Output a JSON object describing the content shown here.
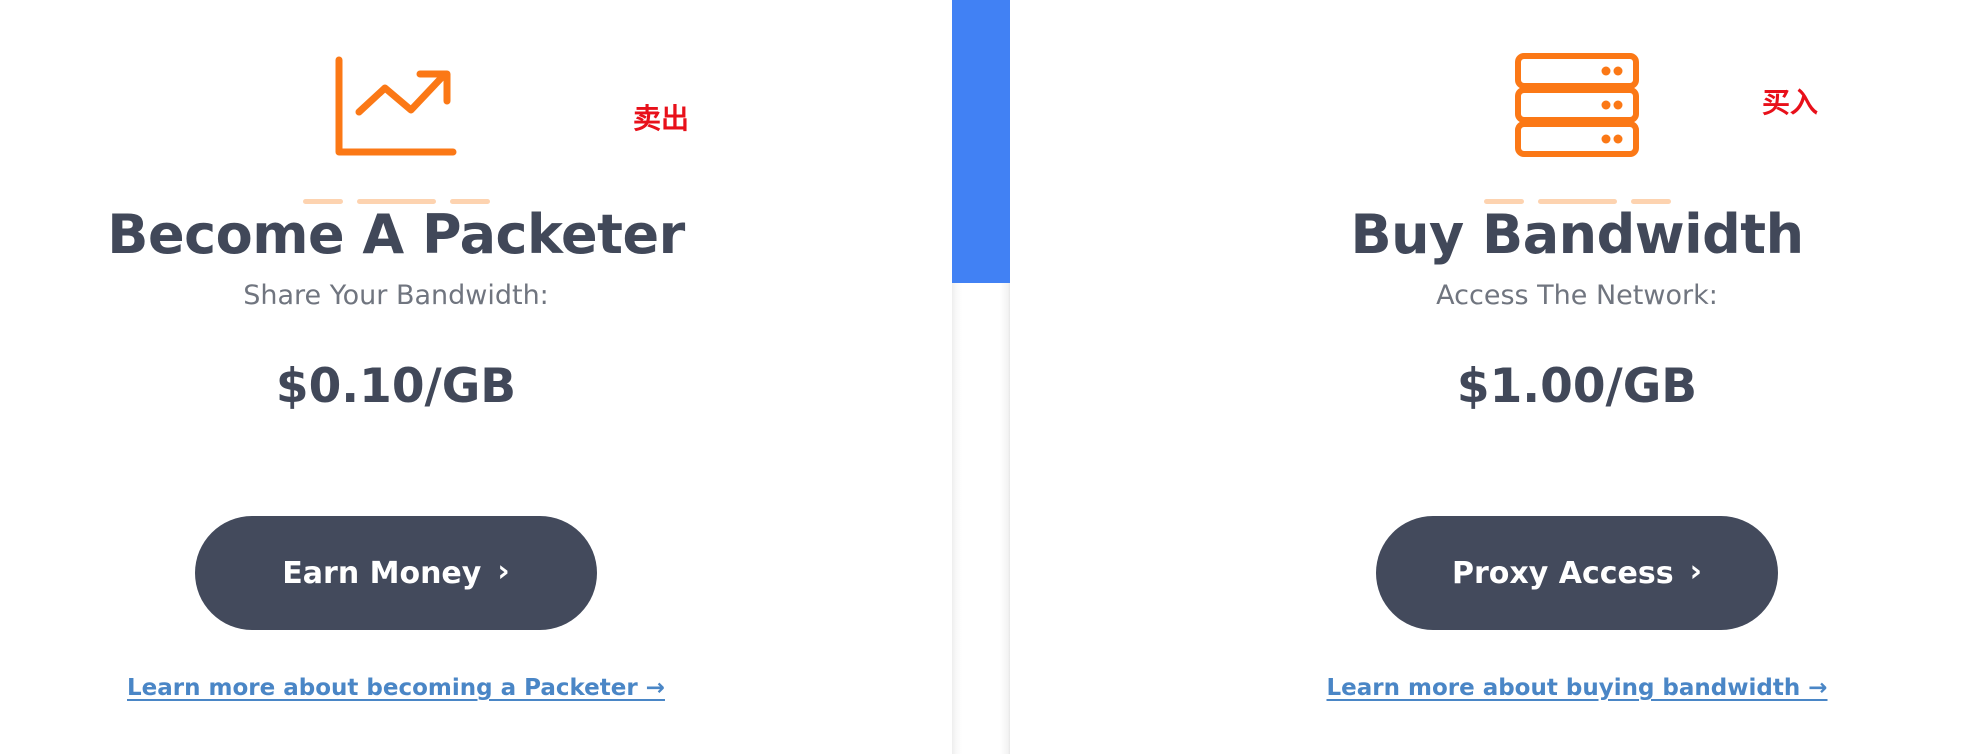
{
  "left_card": {
    "icon": "chart-trend-up-icon",
    "title": "Become A Packeter",
    "subtitle": "Share Your Bandwidth:",
    "price": "$0.10/GB",
    "button_label": "Earn Money",
    "button_chevron": "›",
    "learn_more": "Learn more about becoming a Packeter →",
    "annotation": "卖出"
  },
  "right_card": {
    "icon": "server-stack-icon",
    "title": "Buy Bandwidth",
    "subtitle": "Access The Network:",
    "price": "$1.00/GB",
    "button_label": "Proxy Access",
    "button_chevron": "›",
    "learn_more": "Learn more about buying bandwidth →",
    "annotation": "买入"
  },
  "colors": {
    "accent_orange": "#fb7816",
    "dash_peach": "#fdd3b0",
    "text_dark": "#414859",
    "text_muted": "#70757f",
    "button_bg": "#434a5c",
    "link_blue": "#4a86c6",
    "annotation_red": "#e8101a",
    "divider_blue": "#4181f4"
  }
}
